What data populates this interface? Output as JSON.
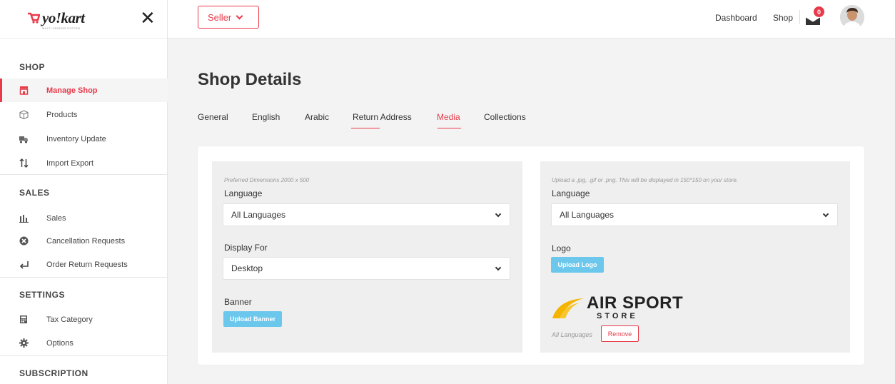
{
  "brand": {
    "logo_text": "yo!kart",
    "logo_sub": "MULTI VENDOR SYSTEM"
  },
  "sidebar": {
    "sections": [
      {
        "title": "SHOP",
        "items": [
          {
            "label": "Manage Shop",
            "icon": "shop-icon",
            "active": true
          },
          {
            "label": "Products",
            "icon": "box-icon"
          },
          {
            "label": "Inventory Update",
            "icon": "inventory-icon"
          },
          {
            "label": "Import Export",
            "icon": "sort-arrows-icon"
          }
        ]
      },
      {
        "title": "SALES",
        "items": [
          {
            "label": "Sales",
            "icon": "bar-chart-icon"
          },
          {
            "label": "Cancellation Requests",
            "icon": "cancel-circle-icon"
          },
          {
            "label": "Order Return Requests",
            "icon": "return-arrow-icon"
          }
        ]
      },
      {
        "title": "SETTINGS",
        "items": [
          {
            "label": "Tax Category",
            "icon": "calculator-icon"
          },
          {
            "label": "Options",
            "icon": "gear-icon"
          }
        ]
      },
      {
        "title": "SUBSCRIPTION",
        "items": []
      }
    ]
  },
  "topbar": {
    "seller_label": "Seller",
    "dashboard_link": "Dashboard",
    "shop_link": "Shop",
    "notifications_count": "0"
  },
  "main": {
    "title": "Shop Details",
    "tabs": [
      {
        "label": "General"
      },
      {
        "label": "English"
      },
      {
        "label": "Arabic"
      },
      {
        "label": "Return Address",
        "underlined": true
      },
      {
        "label": "Media",
        "active": true
      },
      {
        "label": "Collections"
      }
    ],
    "banner_panel": {
      "hint": "Preferred Dimensions 2000 x 500",
      "language_label": "Language",
      "language_value": "All Languages",
      "display_for_label": "Display For",
      "display_for_value": "Desktop",
      "banner_label": "Banner",
      "upload_label": "Upload Banner"
    },
    "logo_panel": {
      "hint": "Upload a .jpg, .gif or .png. This will be displayed in 150*150 on your store.",
      "language_label": "Language",
      "language_value": "All Languages",
      "logo_label": "Logo",
      "upload_label": "Upload Logo",
      "preview_line1": "AIR SPORT",
      "preview_line2": "STORE",
      "preview_language": "All Languages",
      "remove_label": "Remove"
    }
  },
  "colors": {
    "accent": "#e83a4a",
    "upload": "#6cc7ec",
    "panel": "#efefef",
    "background": "#f3f3f3"
  }
}
